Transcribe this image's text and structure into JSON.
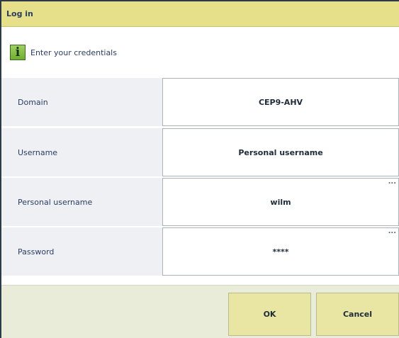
{
  "dialog": {
    "title": "Log in",
    "info": {
      "icon": "info-icon",
      "icon_glyph": "i",
      "text": "Enter your credentials"
    },
    "fields": [
      {
        "label": "Domain",
        "value": "CEP9-AHV",
        "has_more": false
      },
      {
        "label": "Username",
        "value": "Personal username",
        "has_more": false
      },
      {
        "label": "Personal username",
        "value": "wilm",
        "has_more": true,
        "more": "..."
      },
      {
        "label": "Password",
        "value": "****",
        "has_more": true,
        "more": "..."
      }
    ],
    "buttons": {
      "ok": "OK",
      "cancel": "Cancel"
    }
  },
  "colors": {
    "title_bar": "#e6e08a",
    "row_background": "#eef0f3",
    "footer": "#eaecda",
    "button": "#e8e6a2",
    "info_icon": "#7fbc3c"
  }
}
